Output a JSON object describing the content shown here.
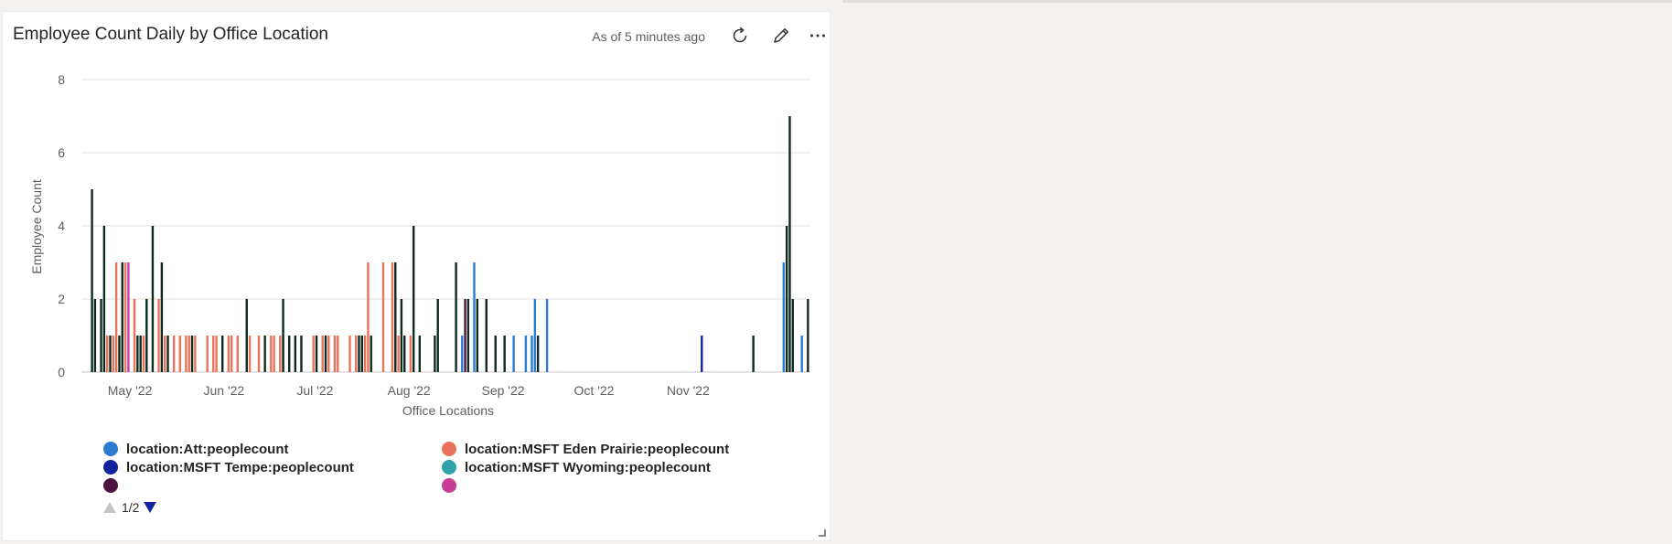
{
  "card": {
    "title": "Employee Count Daily by Office Location",
    "as_of": "As of 5 minutes ago",
    "refresh_icon": "refresh-icon",
    "edit_icon": "pencil-icon",
    "more_icon": "more-icon"
  },
  "legend": {
    "page": "1/2",
    "items": [
      {
        "label": "location:Att:peoplecount",
        "color": "#2b7bd0"
      },
      {
        "label": "location:MSFT Eden Prairie:peoplecount",
        "color": "#e8735a"
      },
      {
        "label": "location:MSFT Tempe:peoplecount",
        "color": "#12239e"
      },
      {
        "label": "location:MSFT Wyoming:peoplecount",
        "color": "#2fa3a9"
      },
      {
        "label": "",
        "color": "#4b1540"
      },
      {
        "label": "",
        "color": "#c83d95"
      }
    ]
  },
  "chart_data": {
    "type": "bar",
    "xlabel": "Office Locations",
    "ylabel": "Employee Count",
    "ylim": [
      0,
      8
    ],
    "yticks": [
      0,
      2,
      4,
      6,
      8
    ],
    "xlim": [
      "2022-04-15",
      "2022-12-11"
    ],
    "xticks": [
      {
        "date": "2022-05-01",
        "label": "May '22"
      },
      {
        "date": "2022-06-01",
        "label": "Jun '22"
      },
      {
        "date": "2022-07-01",
        "label": "Jul '22"
      },
      {
        "date": "2022-08-01",
        "label": "Aug '22"
      },
      {
        "date": "2022-09-01",
        "label": "Sep '22"
      },
      {
        "date": "2022-10-01",
        "label": "Oct '22"
      },
      {
        "date": "2022-11-01",
        "label": "Nov '22"
      }
    ],
    "grid": true,
    "series": [
      {
        "name": "location:Att:peoplecount",
        "color": "#2b7bd0",
        "points": [
          [
            "2022-08-18",
            1
          ],
          [
            "2022-08-22",
            3
          ],
          [
            "2022-09-04",
            1
          ],
          [
            "2022-09-08",
            1
          ],
          [
            "2022-09-10",
            1
          ],
          [
            "2022-09-11",
            2
          ],
          [
            "2022-09-15",
            2
          ],
          [
            "2022-12-02",
            3
          ],
          [
            "2022-12-08",
            1
          ]
        ]
      },
      {
        "name": "location:MSFT Eden Prairie:peoplecount",
        "color": "#e8735a",
        "points": [
          [
            "2022-04-23",
            1
          ],
          [
            "2022-04-25",
            1
          ],
          [
            "2022-04-26",
            3
          ],
          [
            "2022-04-29",
            3
          ],
          [
            "2022-05-02",
            2
          ],
          [
            "2022-05-05",
            1
          ],
          [
            "2022-05-10",
            2
          ],
          [
            "2022-05-12",
            1
          ],
          [
            "2022-05-15",
            1
          ],
          [
            "2022-05-17",
            1
          ],
          [
            "2022-05-19",
            1
          ],
          [
            "2022-05-20",
            1
          ],
          [
            "2022-05-22",
            1
          ],
          [
            "2022-05-26",
            1
          ],
          [
            "2022-05-28",
            1
          ],
          [
            "2022-05-29",
            1
          ],
          [
            "2022-06-02",
            1
          ],
          [
            "2022-06-03",
            1
          ],
          [
            "2022-06-05",
            1
          ],
          [
            "2022-06-09",
            1
          ],
          [
            "2022-06-12",
            1
          ],
          [
            "2022-06-16",
            1
          ],
          [
            "2022-06-17",
            1
          ],
          [
            "2022-06-19",
            1
          ],
          [
            "2022-06-20",
            1
          ],
          [
            "2022-06-30",
            1
          ],
          [
            "2022-07-03",
            1
          ],
          [
            "2022-07-05",
            1
          ],
          [
            "2022-07-07",
            1
          ],
          [
            "2022-07-08",
            1
          ],
          [
            "2022-07-12",
            1
          ],
          [
            "2022-07-14",
            1
          ],
          [
            "2022-07-17",
            1
          ],
          [
            "2022-07-18",
            3
          ],
          [
            "2022-07-23",
            3
          ],
          [
            "2022-07-26",
            3
          ],
          [
            "2022-07-28",
            1
          ],
          [
            "2022-08-01",
            1
          ]
        ]
      },
      {
        "name": "location:MSFT Tempe:peoplecount",
        "color": "#12239e",
        "points": [
          [
            "2022-11-05",
            1
          ]
        ]
      },
      {
        "name": "location:MSFT Wyoming:peoplecount",
        "color": "#2fa3a9",
        "points": []
      },
      {
        "name": "",
        "color": "#4b1540",
        "points": [
          [
            "2022-08-19",
            2
          ]
        ]
      },
      {
        "name": "",
        "color": "#c83d95",
        "points": [
          [
            "2022-04-30",
            3
          ]
        ]
      },
      {
        "name": "",
        "color": "#0d2a1f",
        "points": [
          [
            "2022-04-18",
            5
          ],
          [
            "2022-04-19",
            2
          ],
          [
            "2022-04-21",
            2
          ],
          [
            "2022-04-22",
            4
          ],
          [
            "2022-04-24",
            1
          ],
          [
            "2022-04-27",
            1
          ],
          [
            "2022-04-28",
            3
          ],
          [
            "2022-05-03",
            1
          ],
          [
            "2022-05-04",
            1
          ],
          [
            "2022-05-06",
            2
          ],
          [
            "2022-05-08",
            4
          ],
          [
            "2022-05-11",
            3
          ],
          [
            "2022-05-13",
            1
          ],
          [
            "2022-05-21",
            1
          ],
          [
            "2022-05-31",
            1
          ],
          [
            "2022-06-08",
            2
          ],
          [
            "2022-06-14",
            1
          ],
          [
            "2022-06-20",
            2
          ],
          [
            "2022-06-22",
            1
          ],
          [
            "2022-06-24",
            1
          ],
          [
            "2022-06-26",
            1
          ],
          [
            "2022-07-01",
            1
          ],
          [
            "2022-07-04",
            1
          ],
          [
            "2022-07-15",
            1
          ],
          [
            "2022-07-16",
            1
          ],
          [
            "2022-07-19",
            1
          ],
          [
            "2022-07-27",
            3
          ],
          [
            "2022-07-29",
            2
          ],
          [
            "2022-07-30",
            1
          ],
          [
            "2022-08-02",
            4
          ],
          [
            "2022-08-04",
            1
          ],
          [
            "2022-08-09",
            1
          ],
          [
            "2022-08-10",
            2
          ],
          [
            "2022-08-16",
            3
          ],
          [
            "2022-08-20",
            2
          ],
          [
            "2022-08-23",
            2
          ],
          [
            "2022-08-26",
            2
          ],
          [
            "2022-08-29",
            1
          ],
          [
            "2022-09-01",
            1
          ],
          [
            "2022-09-12",
            1
          ],
          [
            "2022-11-22",
            1
          ],
          [
            "2022-12-03",
            4
          ],
          [
            "2022-12-04",
            7
          ],
          [
            "2022-12-05",
            2
          ],
          [
            "2022-12-10",
            2
          ]
        ]
      }
    ]
  }
}
